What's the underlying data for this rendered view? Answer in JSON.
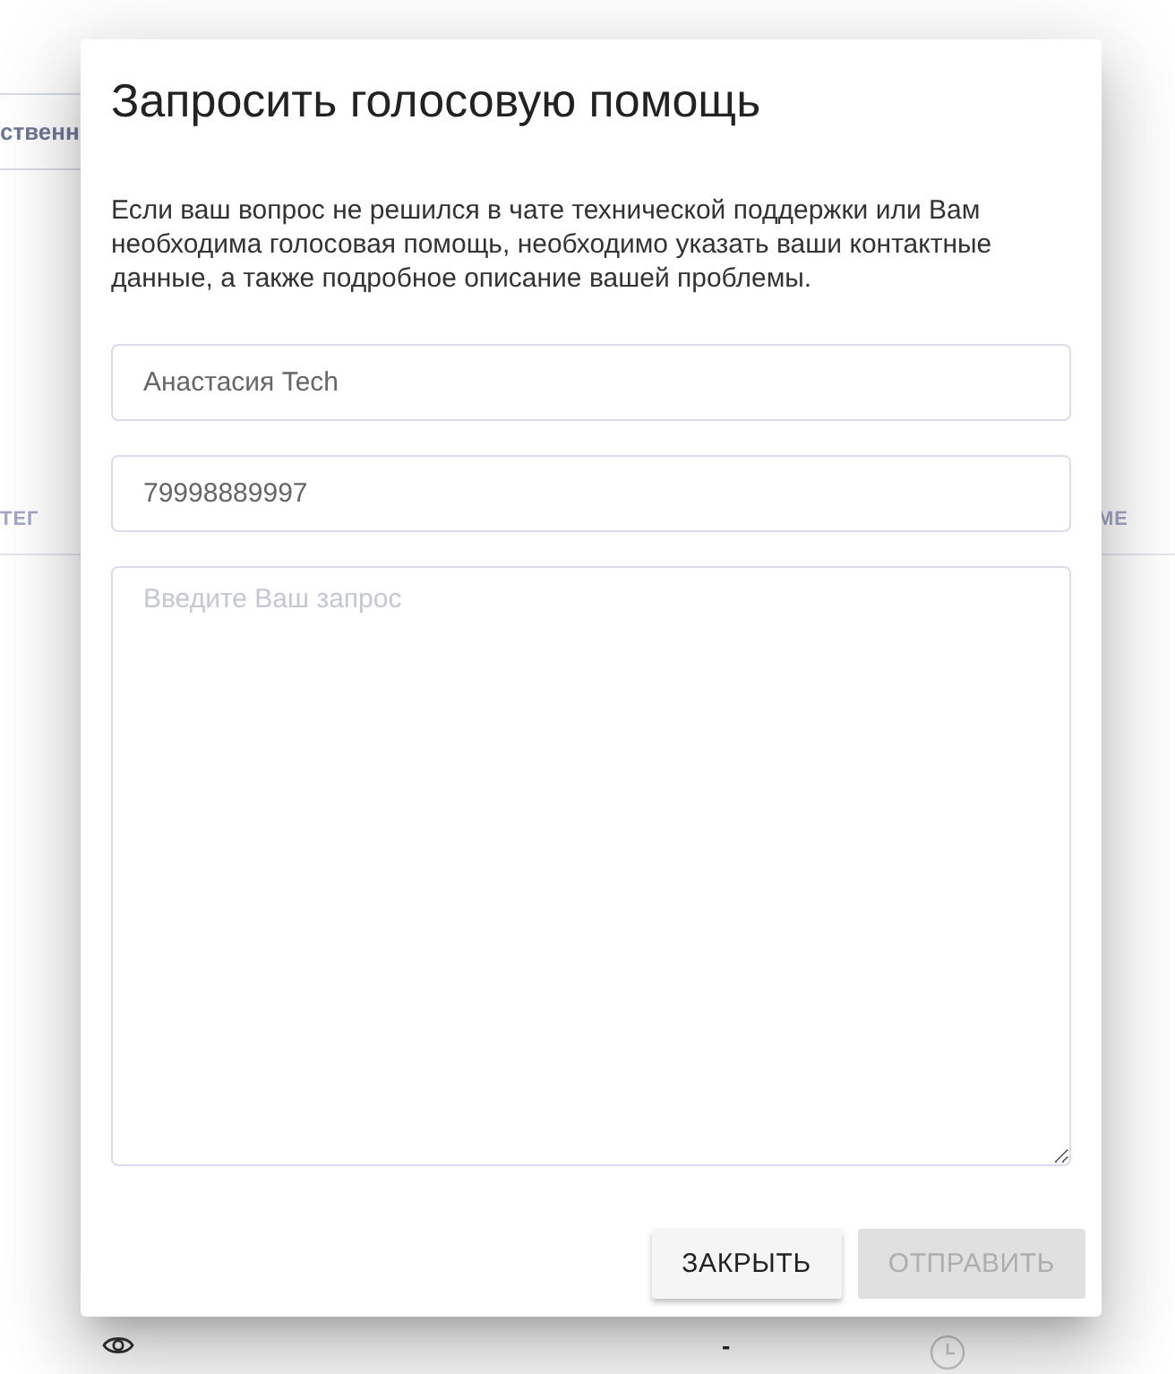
{
  "background": {
    "filter_button": {
      "label": "ственн"
    },
    "columns": [
      {
        "label": "ТЕГ"
      },
      {
        "label": "МЕ"
      }
    ],
    "row": {
      "value": "-"
    }
  },
  "dialog": {
    "title": "Запросить голосовую помощь",
    "description": "Если ваш вопрос не решился в чате технической поддержки или Вам необходима голосовая помощь, необходимо указать ваши контактные данные, а также подробное описание вашей проблемы.",
    "fields": [
      {
        "kind": "input",
        "value": "Анастасия Tech"
      },
      {
        "kind": "input",
        "value": "79998889997"
      },
      {
        "kind": "textarea",
        "placeholder": "Введите Ваш запрос"
      }
    ],
    "buttons": [
      {
        "label": "ЗАКРЫТЬ",
        "disabled": false
      },
      {
        "label": "ОТПРАВИТЬ",
        "disabled": true
      }
    ]
  }
}
